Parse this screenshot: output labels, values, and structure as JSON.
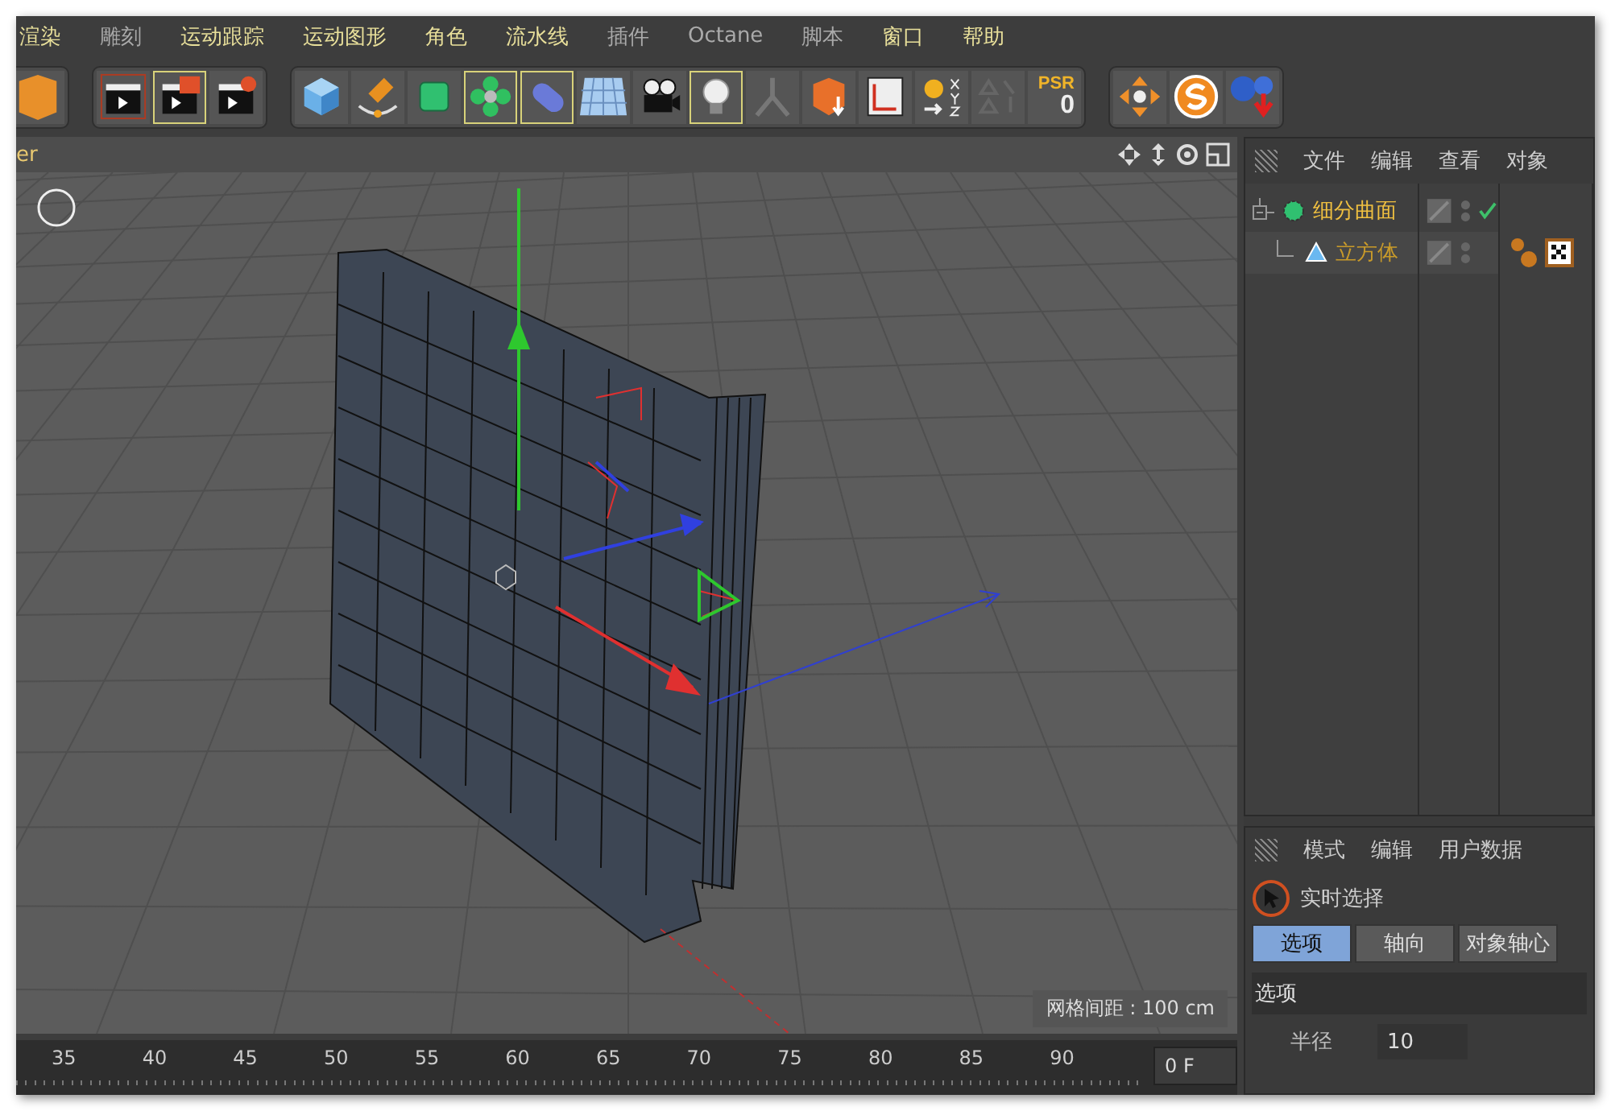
{
  "menu": [
    {
      "label": "渲染",
      "highlighted": true
    },
    {
      "label": "雕刻",
      "highlighted": false
    },
    {
      "label": "运动跟踪",
      "highlighted": true
    },
    {
      "label": "运动图形",
      "highlighted": true
    },
    {
      "label": "角色",
      "highlighted": true
    },
    {
      "label": "流水线",
      "highlighted": true
    },
    {
      "label": "插件",
      "highlighted": false
    },
    {
      "label": "Octane",
      "highlighted": false
    },
    {
      "label": "脚本",
      "highlighted": false
    },
    {
      "label": "窗口",
      "highlighted": true
    },
    {
      "label": "帮助",
      "highlighted": true
    }
  ],
  "toolbar": [
    {
      "buttons": [
        {
          "kind": "orange-cut",
          "active": false
        }
      ]
    },
    {
      "buttons": [
        {
          "kind": "clapboard",
          "active": false
        },
        {
          "kind": "clapboard-window",
          "active": true
        },
        {
          "kind": "clapboard-gear",
          "active": false
        }
      ]
    },
    {
      "buttons": [
        {
          "kind": "cube",
          "active": false
        },
        {
          "kind": "pen",
          "active": false
        },
        {
          "kind": "green-cube",
          "active": false
        },
        {
          "kind": "flower",
          "active": true
        },
        {
          "kind": "pill",
          "active": true
        },
        {
          "kind": "floor",
          "active": false
        },
        {
          "kind": "camera",
          "active": false
        },
        {
          "kind": "bulb",
          "active": true
        },
        {
          "kind": "figure",
          "active": false
        },
        {
          "kind": "orange-box",
          "active": false
        },
        {
          "kind": "axes",
          "active": false
        },
        {
          "kind": "xyz",
          "active": false
        },
        {
          "kind": "triangles",
          "active": false
        },
        {
          "kind": "psr",
          "active": false,
          "label": "PSR",
          "value": "0"
        }
      ]
    },
    {
      "buttons": [
        {
          "kind": "snap",
          "active": false
        },
        {
          "kind": "s-circle",
          "active": false
        },
        {
          "kind": "spheres",
          "active": false
        }
      ]
    }
  ],
  "viewport": {
    "title": "er",
    "grid_spacing": "网格间距 : 100 cm"
  },
  "object_manager": {
    "menu": [
      "文件",
      "编辑",
      "查看",
      "对象"
    ],
    "tree": [
      {
        "name": "细分曲面",
        "kind": "subdivision",
        "checked": true,
        "children": [
          {
            "name": "立方体",
            "kind": "cube",
            "checked": false,
            "tags": [
              {
                "kind": "material"
              },
              {
                "kind": "texture"
              }
            ]
          }
        ]
      }
    ]
  },
  "attributes": {
    "menu": [
      "模式",
      "编辑",
      "用户数据"
    ],
    "tool": "实时选择",
    "tabs": [
      {
        "label": "选项",
        "selected": true
      },
      {
        "label": "轴向",
        "selected": false
      },
      {
        "label": "对象轴心",
        "selected": false
      }
    ],
    "section": "选项",
    "fields": [
      {
        "label": "半径",
        "value": "10"
      }
    ]
  },
  "timeline": {
    "ticks": [
      "35",
      "40",
      "45",
      "50",
      "55",
      "60",
      "65",
      "70",
      "75",
      "80",
      "85",
      "90"
    ],
    "frame": "0 F"
  }
}
